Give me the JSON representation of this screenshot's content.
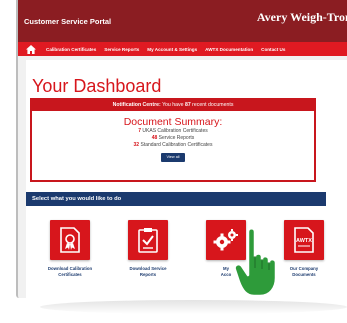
{
  "header": {
    "portal_title": "Customer Service Portal",
    "brand": "Avery Weigh-Tronix"
  },
  "nav": {
    "items": [
      {
        "label": "Calibration Certificates"
      },
      {
        "label": "Service Reports"
      },
      {
        "label": "My Account & Settings"
      },
      {
        "label": "AWTX Documentation"
      },
      {
        "label": "Contact Us"
      }
    ]
  },
  "dashboard": {
    "title": "Your Dashboard"
  },
  "notification": {
    "prefix": "Notification Centre:",
    "text_before": " You have ",
    "count": "87",
    "text_after": " recent documents"
  },
  "summary": {
    "title": "Document Summary:",
    "lines": [
      {
        "num": "7",
        "text": " UKAS Calibration Certificates"
      },
      {
        "num": "48",
        "text": " Service Reports"
      },
      {
        "num": "32",
        "text": " Standard Calibration Certificates"
      }
    ],
    "view_all": "View all"
  },
  "select_prompt": "Select what you would like to do",
  "tiles": [
    {
      "line1": "Download Calibration",
      "line2": "Certificates",
      "icon": "certificate-icon"
    },
    {
      "line1": "Download Service",
      "line2": "Reports",
      "icon": "report-icon"
    },
    {
      "line1": "My",
      "line2": "Acco",
      "icon": "gears-icon"
    },
    {
      "line1": "Our Company",
      "line2": "Documents",
      "icon": "awtx-document-icon"
    }
  ],
  "tile4_badge": "AWTX",
  "colors": {
    "header": "#8b1d22",
    "nav": "#e01a22",
    "accent": "#d7161c",
    "navy": "#1b3a6e",
    "hand": "#2e9b3a"
  }
}
